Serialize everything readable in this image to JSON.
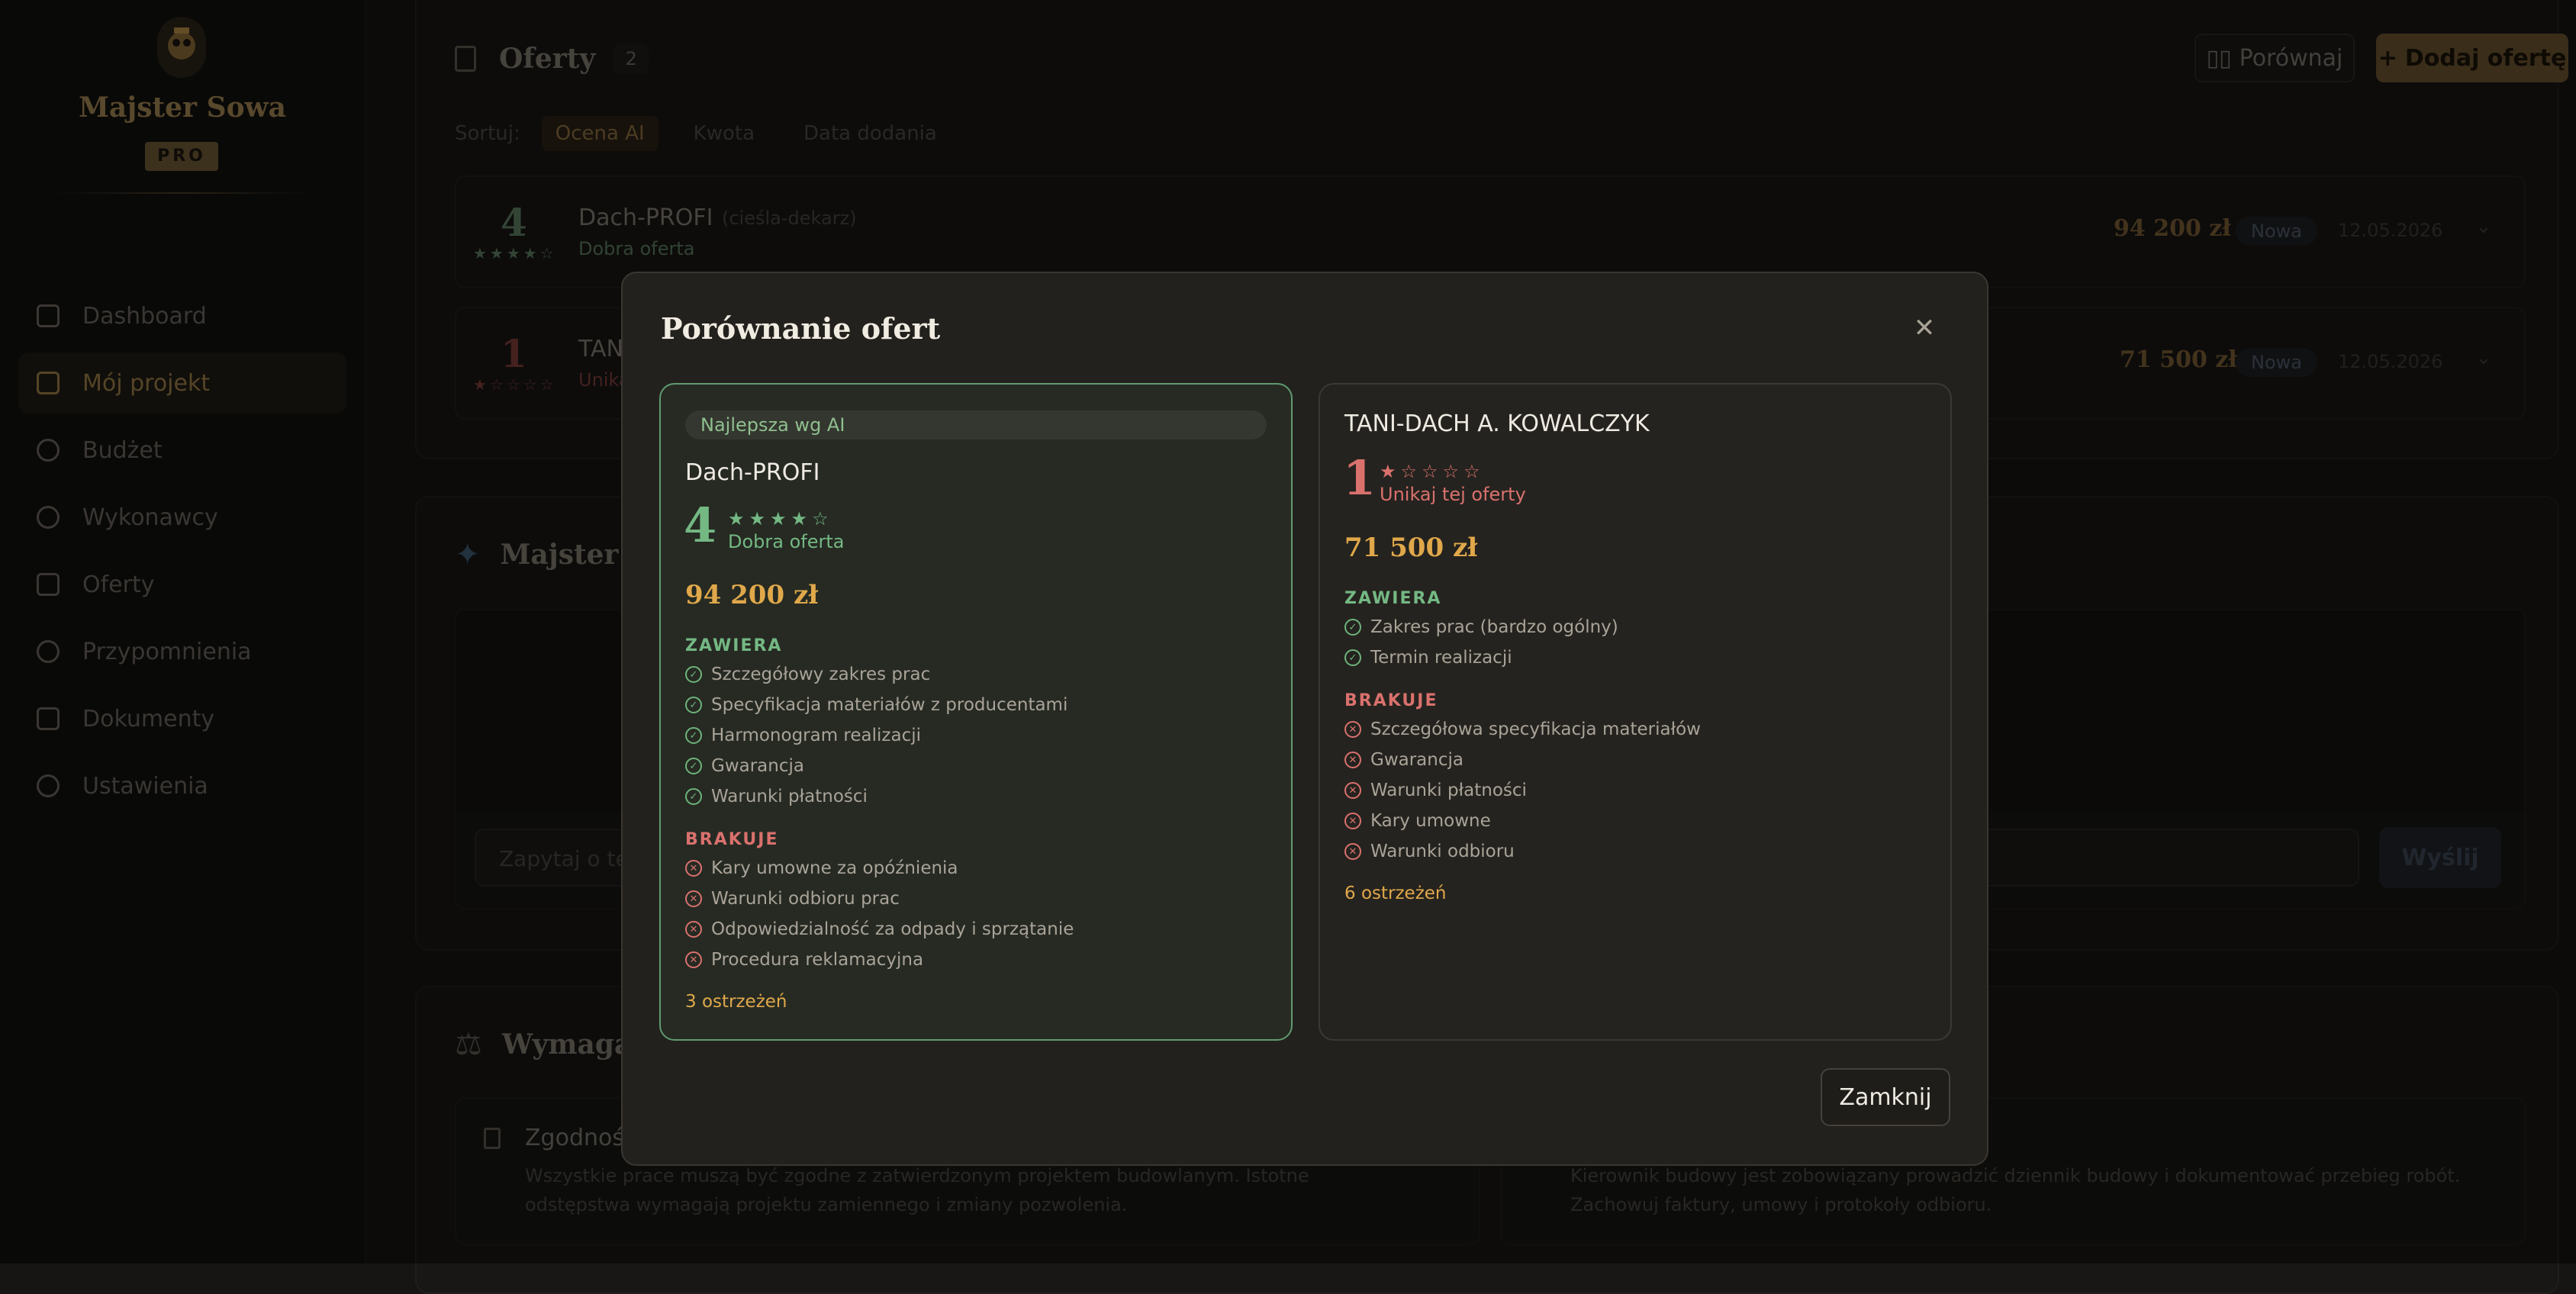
{
  "brand": {
    "name": "Majster Sowa",
    "tier": "PRO"
  },
  "nav": [
    {
      "label": "Dashboard",
      "icon": "grid-icon"
    },
    {
      "label": "Mój projekt",
      "icon": "home-icon",
      "active": true
    },
    {
      "label": "Budżet",
      "icon": "coin-icon"
    },
    {
      "label": "Wykonawcy",
      "icon": "users-icon"
    },
    {
      "label": "Oferty",
      "icon": "calendar-icon"
    },
    {
      "label": "Przypomnienia",
      "icon": "bell-icon"
    },
    {
      "label": "Dokumenty",
      "icon": "document-icon"
    },
    {
      "label": "Ustawienia",
      "icon": "gear-icon"
    }
  ],
  "offers_section": {
    "title": "Oferty",
    "count": "2",
    "compare_label": "Porównaj",
    "add_label": "Dodaj ofertę",
    "sort_label": "Sortuj:",
    "sort_options": [
      "Ocena AI",
      "Kwota",
      "Data dodania"
    ],
    "rows": [
      {
        "score": "4",
        "name": "Dach-PROFI",
        "category": "(cieśla-dekarz)",
        "verdict": "Dobra oferta",
        "price": "94 200 zł",
        "status": "Nowa",
        "date": "12.05.2026"
      },
      {
        "score": "1",
        "name": "TANI",
        "verdict": "Unika",
        "price": "71 500 zł",
        "status": "Nowa",
        "date": "12.05.2026"
      }
    ]
  },
  "assistant_section": {
    "title": "Majster S",
    "input_placeholder": "Zapytaj o te",
    "send_label": "Wyślij"
  },
  "requirements_section": {
    "title": "Wymaga",
    "cards": [
      {
        "title": "Zgodnoś",
        "text": "Wszystkie prace muszą być zgodne z zatwierdzonym projektem budowlanym. Istotne odstępstwa wymagają projektu zamiennego i zmiany pozwolenia."
      },
      {
        "title": "",
        "text": "Kierownik budowy jest zobowiązany prowadzić dziennik budowy i dokumentować przebieg robót. Zachowuj faktury, umowy i protokoły odbioru."
      }
    ]
  },
  "modal": {
    "title": "Porównanie ofert",
    "close_label": "Zamknij",
    "best": {
      "badge": "Najlepsza wg AI",
      "name": "Dach-PROFI",
      "score": "4",
      "stars": "★★★★☆",
      "verdict": "Dobra oferta",
      "price": "94 200 zł",
      "includes_head": "ZAWIERA",
      "includes": [
        "Szczegółowy zakres prac",
        "Specyfikacja materiałów z producentami",
        "Harmonogram realizacji",
        "Gwarancja",
        "Warunki płatności"
      ],
      "missing_head": "BRAKUJE",
      "missing": [
        "Kary umowne za opóźnienia",
        "Warunki odbioru prac",
        "Odpowiedzialność za odpady i sprzątanie",
        "Procedura reklamacyjna"
      ],
      "warnings": "3 ostrzeżeń"
    },
    "other": {
      "name": "TANI-DACH A. KOWALCZYK",
      "score": "1",
      "stars": "★☆☆☆☆",
      "verdict": "Unikaj tej oferty",
      "price": "71 500 zł",
      "includes_head": "ZAWIERA",
      "includes": [
        "Zakres prac (bardzo ogólny)",
        "Termin realizacji"
      ],
      "missing_head": "BRAKUJE",
      "missing": [
        "Szczegółowa specyfikacja materiałów",
        "Gwarancja",
        "Warunki płatności",
        "Kary umowne",
        "Warunki odbioru"
      ],
      "warnings": "6 ostrzeżeń"
    }
  },
  "colors": {
    "gold": "#e0a84a",
    "green": "#74b883",
    "red": "#d9716d",
    "accent": "#9b7e47"
  }
}
